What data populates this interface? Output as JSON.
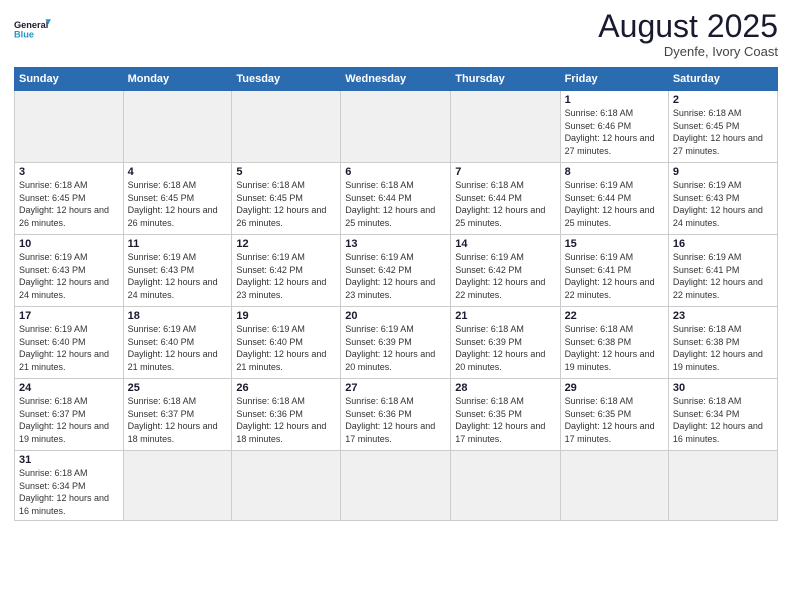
{
  "logo": {
    "text_general": "General",
    "text_blue": "Blue"
  },
  "header": {
    "month_year": "August 2025",
    "location": "Dyenfe, Ivory Coast"
  },
  "weekdays": [
    "Sunday",
    "Monday",
    "Tuesday",
    "Wednesday",
    "Thursday",
    "Friday",
    "Saturday"
  ],
  "weeks": [
    [
      {
        "day": "",
        "info": ""
      },
      {
        "day": "",
        "info": ""
      },
      {
        "day": "",
        "info": ""
      },
      {
        "day": "",
        "info": ""
      },
      {
        "day": "",
        "info": ""
      },
      {
        "day": "1",
        "info": "Sunrise: 6:18 AM\nSunset: 6:46 PM\nDaylight: 12 hours and 27 minutes."
      },
      {
        "day": "2",
        "info": "Sunrise: 6:18 AM\nSunset: 6:45 PM\nDaylight: 12 hours and 27 minutes."
      }
    ],
    [
      {
        "day": "3",
        "info": "Sunrise: 6:18 AM\nSunset: 6:45 PM\nDaylight: 12 hours and 26 minutes."
      },
      {
        "day": "4",
        "info": "Sunrise: 6:18 AM\nSunset: 6:45 PM\nDaylight: 12 hours and 26 minutes."
      },
      {
        "day": "5",
        "info": "Sunrise: 6:18 AM\nSunset: 6:45 PM\nDaylight: 12 hours and 26 minutes."
      },
      {
        "day": "6",
        "info": "Sunrise: 6:18 AM\nSunset: 6:44 PM\nDaylight: 12 hours and 25 minutes."
      },
      {
        "day": "7",
        "info": "Sunrise: 6:18 AM\nSunset: 6:44 PM\nDaylight: 12 hours and 25 minutes."
      },
      {
        "day": "8",
        "info": "Sunrise: 6:19 AM\nSunset: 6:44 PM\nDaylight: 12 hours and 25 minutes."
      },
      {
        "day": "9",
        "info": "Sunrise: 6:19 AM\nSunset: 6:43 PM\nDaylight: 12 hours and 24 minutes."
      }
    ],
    [
      {
        "day": "10",
        "info": "Sunrise: 6:19 AM\nSunset: 6:43 PM\nDaylight: 12 hours and 24 minutes."
      },
      {
        "day": "11",
        "info": "Sunrise: 6:19 AM\nSunset: 6:43 PM\nDaylight: 12 hours and 24 minutes."
      },
      {
        "day": "12",
        "info": "Sunrise: 6:19 AM\nSunset: 6:42 PM\nDaylight: 12 hours and 23 minutes."
      },
      {
        "day": "13",
        "info": "Sunrise: 6:19 AM\nSunset: 6:42 PM\nDaylight: 12 hours and 23 minutes."
      },
      {
        "day": "14",
        "info": "Sunrise: 6:19 AM\nSunset: 6:42 PM\nDaylight: 12 hours and 22 minutes."
      },
      {
        "day": "15",
        "info": "Sunrise: 6:19 AM\nSunset: 6:41 PM\nDaylight: 12 hours and 22 minutes."
      },
      {
        "day": "16",
        "info": "Sunrise: 6:19 AM\nSunset: 6:41 PM\nDaylight: 12 hours and 22 minutes."
      }
    ],
    [
      {
        "day": "17",
        "info": "Sunrise: 6:19 AM\nSunset: 6:40 PM\nDaylight: 12 hours and 21 minutes."
      },
      {
        "day": "18",
        "info": "Sunrise: 6:19 AM\nSunset: 6:40 PM\nDaylight: 12 hours and 21 minutes."
      },
      {
        "day": "19",
        "info": "Sunrise: 6:19 AM\nSunset: 6:40 PM\nDaylight: 12 hours and 21 minutes."
      },
      {
        "day": "20",
        "info": "Sunrise: 6:19 AM\nSunset: 6:39 PM\nDaylight: 12 hours and 20 minutes."
      },
      {
        "day": "21",
        "info": "Sunrise: 6:18 AM\nSunset: 6:39 PM\nDaylight: 12 hours and 20 minutes."
      },
      {
        "day": "22",
        "info": "Sunrise: 6:18 AM\nSunset: 6:38 PM\nDaylight: 12 hours and 19 minutes."
      },
      {
        "day": "23",
        "info": "Sunrise: 6:18 AM\nSunset: 6:38 PM\nDaylight: 12 hours and 19 minutes."
      }
    ],
    [
      {
        "day": "24",
        "info": "Sunrise: 6:18 AM\nSunset: 6:37 PM\nDaylight: 12 hours and 19 minutes."
      },
      {
        "day": "25",
        "info": "Sunrise: 6:18 AM\nSunset: 6:37 PM\nDaylight: 12 hours and 18 minutes."
      },
      {
        "day": "26",
        "info": "Sunrise: 6:18 AM\nSunset: 6:36 PM\nDaylight: 12 hours and 18 minutes."
      },
      {
        "day": "27",
        "info": "Sunrise: 6:18 AM\nSunset: 6:36 PM\nDaylight: 12 hours and 17 minutes."
      },
      {
        "day": "28",
        "info": "Sunrise: 6:18 AM\nSunset: 6:35 PM\nDaylight: 12 hours and 17 minutes."
      },
      {
        "day": "29",
        "info": "Sunrise: 6:18 AM\nSunset: 6:35 PM\nDaylight: 12 hours and 17 minutes."
      },
      {
        "day": "30",
        "info": "Sunrise: 6:18 AM\nSunset: 6:34 PM\nDaylight: 12 hours and 16 minutes."
      }
    ],
    [
      {
        "day": "31",
        "info": "Sunrise: 6:18 AM\nSunset: 6:34 PM\nDaylight: 12 hours and 16 minutes."
      },
      {
        "day": "",
        "info": ""
      },
      {
        "day": "",
        "info": ""
      },
      {
        "day": "",
        "info": ""
      },
      {
        "day": "",
        "info": ""
      },
      {
        "day": "",
        "info": ""
      },
      {
        "day": "",
        "info": ""
      }
    ]
  ]
}
